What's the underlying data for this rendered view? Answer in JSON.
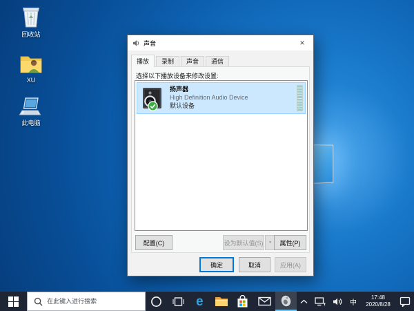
{
  "colors": {
    "accent": "#0078d7",
    "selection_bg": "#cce8ff",
    "selection_border": "#99d1ff",
    "taskbar_bg": "#1e2636",
    "desktop_center": "#2e93e2",
    "desktop_edge": "#063d7c"
  },
  "icons": {
    "edge_glyph": "e"
  },
  "desktop": {
    "icons": [
      {
        "id": "recycle-bin",
        "label": "回收站"
      },
      {
        "id": "user-folder",
        "label": "XU"
      },
      {
        "id": "this-pc",
        "label": "此电脑"
      }
    ]
  },
  "dialog": {
    "title": "声音",
    "close_glyph": "×",
    "tabs": [
      {
        "label": "播放",
        "active": true
      },
      {
        "label": "录制",
        "active": false
      },
      {
        "label": "声音",
        "active": false
      },
      {
        "label": "通信",
        "active": false
      }
    ],
    "instruction": "选择以下播放设备来修改设置:",
    "device": {
      "name": "扬声器",
      "description": "High Definition Audio Device",
      "status": "默认设备"
    },
    "actions": {
      "configure": "配置(C)",
      "set_default": "设为默认值(S)",
      "set_default_arrow": "▼",
      "properties": "属性(P)"
    },
    "footer": {
      "ok": "确定",
      "cancel": "取消",
      "apply": "应用(A)"
    }
  },
  "taskbar": {
    "search": {
      "placeholder": "在此键入进行搜索"
    },
    "tray": {
      "ime": "中",
      "time": "17:48",
      "date": "2020/8/28"
    }
  }
}
